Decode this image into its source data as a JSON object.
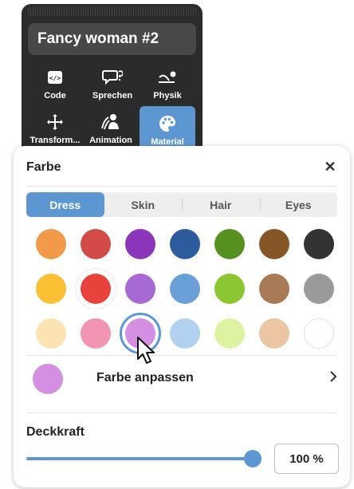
{
  "entity": {
    "name": "Fancy woman #2",
    "tools": [
      {
        "label": "Code",
        "icon": "code-icon"
      },
      {
        "label": "Sprechen",
        "icon": "speech-bubble-icon"
      },
      {
        "label": "Physik",
        "icon": "physics-icon"
      },
      {
        "label": "Transform...",
        "icon": "move-arrows-icon"
      },
      {
        "label": "Animation",
        "icon": "animation-person-icon"
      },
      {
        "label": "Material",
        "icon": "palette-icon",
        "active": true
      }
    ]
  },
  "material_panel": {
    "title": "Farbe",
    "close_icon": "close-icon",
    "tabs": [
      {
        "label": "Dress",
        "active": true
      },
      {
        "label": "Skin"
      },
      {
        "label": "Hair"
      },
      {
        "label": "Eyes"
      }
    ],
    "swatch_rows": [
      [
        "#f29a4a",
        "#d24b47",
        "#8a35ba",
        "#2c5c9e",
        "#56901e",
        "#865525",
        "#333333"
      ],
      [
        "#fbc033",
        "#e8423d",
        "#a769d3",
        "#6a9fd8",
        "#8cc632",
        "#a87a56",
        "#9a9a9a"
      ],
      [
        "#fde3b3",
        "#f295b3",
        "#d58fe2",
        "#b2d1f1",
        "#ddf3a2",
        "#ecc6a3",
        "#ffffff"
      ]
    ],
    "selected_color": "#d58fe2",
    "custom_color": {
      "label": "Farbe anpassen",
      "color": "#d58fe2"
    },
    "opacity": {
      "label": "Deckkraft",
      "value": 1.0,
      "display": "100 %"
    },
    "accent_color": "#5d97d2"
  }
}
